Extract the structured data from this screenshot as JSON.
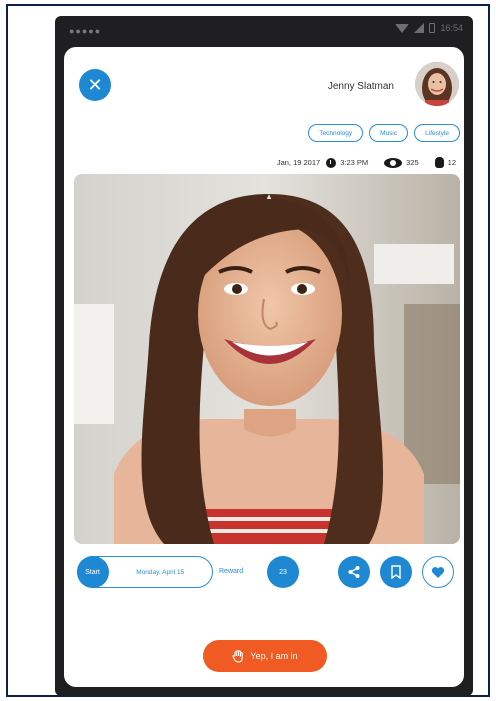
{
  "status_bar": {
    "signal_dots": "●●●●●",
    "time": "16:54"
  },
  "header": {
    "close_icon": "close-icon",
    "author_name": "Jenny Slatman",
    "tags": [
      "Technology",
      "Music",
      "Lifestyle"
    ]
  },
  "meta": {
    "date": "Jan, 19 2017",
    "time": "3:23 PM",
    "views": "325",
    "joins": "12"
  },
  "actions": {
    "start_label": "Start",
    "start_date": "Monday, April 15",
    "reward_label": "Reward",
    "reward_count": "23",
    "share_icon": "share-icon",
    "bookmark_icon": "bookmark-icon",
    "like_icon": "heart-icon"
  },
  "cta": {
    "label": "Yep, I am in",
    "icon": "hand-icon"
  },
  "colors": {
    "accent": "#1e88d2",
    "cta": "#ef5b22",
    "device": "#1f1f21"
  }
}
